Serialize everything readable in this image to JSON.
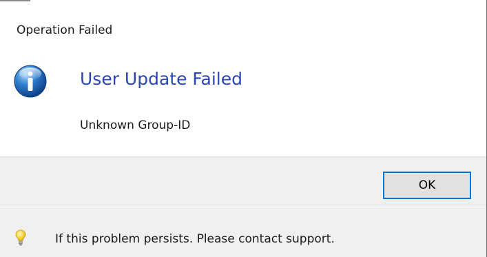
{
  "dialog": {
    "title": "Operation Failed",
    "icon": "info-icon",
    "main_instruction": "User Update Failed",
    "content": "Unknown Group-ID"
  },
  "buttons": {
    "ok_label": "OK"
  },
  "footer": {
    "icon": "lightbulb-icon",
    "text": "If this problem persists. Please contact support."
  },
  "colors": {
    "instruction_text": "#2a46b0",
    "button_focus_border": "#0078d7",
    "band_background": "#f0f0f0"
  }
}
